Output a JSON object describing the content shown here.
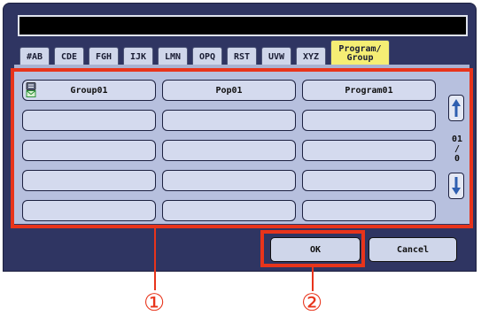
{
  "tabs": [
    "#AB",
    "CDE",
    "FGH",
    "IJK",
    "LMN",
    "OPQ",
    "RST",
    "UVW",
    "XYZ"
  ],
  "active_tab": "Program/\nGroup",
  "destinations": [
    [
      "Group01",
      "Pop01",
      "Program01"
    ],
    [
      "",
      "",
      ""
    ],
    [
      "",
      "",
      ""
    ],
    [
      "",
      "",
      ""
    ],
    [
      "",
      "",
      ""
    ]
  ],
  "page_indicator": {
    "current": "01",
    "separator": "/",
    "total": "0"
  },
  "buttons": {
    "ok": "OK",
    "cancel": "Cancel"
  },
  "callouts": [
    "①",
    "②"
  ],
  "colors": {
    "panel": "#2f3562",
    "active_tab": "#f5ee74",
    "highlight": "#e8341b",
    "grid_bg": "#b7c0de"
  }
}
